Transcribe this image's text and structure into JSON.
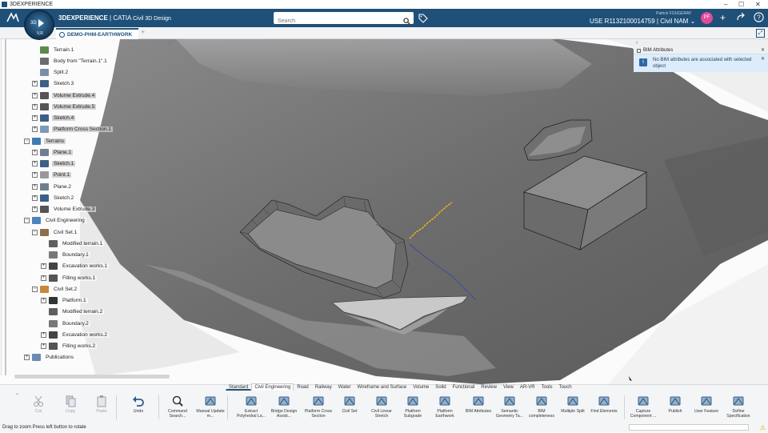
{
  "window": {
    "title": "3DEXPERIENCE",
    "minimize": "–",
    "maximize": "☐",
    "close": "✕"
  },
  "header": {
    "brand_bold": "3DEXPERIENCE",
    "brand_rest": " | CATIA",
    "app_name": "Civil 3D Design",
    "compass_3d": "3D",
    "compass_vr": "V,R",
    "search_placeholder": "Search",
    "user_name": "Patrick FOUGERAY",
    "context": "USE R1132100014759 | Civil NAM",
    "context_chevron": "⌄",
    "avatar": "PF"
  },
  "document_tab": {
    "label": "DEMO-PHM-EARTHWORK",
    "plus": "+"
  },
  "tree": [
    {
      "label": "Terrain.1",
      "indent": 0,
      "exp": "",
      "icon": "terrain",
      "hl": false
    },
    {
      "label": "Body from \"Terrain.1\".1",
      "indent": 0,
      "exp": "",
      "icon": "body",
      "hl": false
    },
    {
      "label": "Split.2",
      "indent": 0,
      "exp": "",
      "icon": "split",
      "hl": false
    },
    {
      "label": "Sketch.3",
      "indent": 0,
      "exp": "+",
      "icon": "sketch",
      "hl": false
    },
    {
      "label": "Volume Extrude.4",
      "indent": 0,
      "exp": "+",
      "icon": "volume",
      "hl": true
    },
    {
      "label": "Volume Extrude.5",
      "indent": 0,
      "exp": "+",
      "icon": "volume",
      "hl": true
    },
    {
      "label": "Sketch.4",
      "indent": 0,
      "exp": "+",
      "icon": "sketch",
      "hl": true
    },
    {
      "label": "Platform Cross Section.1",
      "indent": 0,
      "exp": "+",
      "icon": "cross",
      "hl": true
    },
    {
      "label": "Terrains",
      "indent": -1,
      "exp": "−",
      "icon": "terrains",
      "hl": true
    },
    {
      "label": "Plane.1",
      "indent": 0,
      "exp": "+",
      "icon": "plane",
      "hl": true
    },
    {
      "label": "Sketch.1",
      "indent": 0,
      "exp": "+",
      "icon": "sketch",
      "hl": true
    },
    {
      "label": "Point.1",
      "indent": 0,
      "exp": "+",
      "icon": "point",
      "hl": true
    },
    {
      "label": "Plane.2",
      "indent": 0,
      "exp": "+",
      "icon": "plane",
      "hl": false
    },
    {
      "label": "Sketch.2",
      "indent": 0,
      "exp": "+",
      "icon": "sketch",
      "hl": false
    },
    {
      "label": "Volume Extrude.3",
      "indent": 0,
      "exp": "+",
      "icon": "volume",
      "hl": false
    },
    {
      "label": "Civil Engineering",
      "indent": -1,
      "exp": "−",
      "icon": "civil",
      "hl": false
    },
    {
      "label": "Civil Set.1",
      "indent": 0,
      "exp": "−",
      "icon": "set",
      "hl": false
    },
    {
      "label": "Modified terrain.1",
      "indent": 1,
      "exp": "",
      "icon": "modterrain",
      "hl": false
    },
    {
      "label": "Boundary.1",
      "indent": 1,
      "exp": "",
      "icon": "boundary",
      "hl": false
    },
    {
      "label": "Excavation works.1",
      "indent": 1,
      "exp": "+",
      "icon": "excav",
      "hl": false
    },
    {
      "label": "Filling works.1",
      "indent": 1,
      "exp": "+",
      "icon": "fill",
      "hl": false
    },
    {
      "label": "Civil Set.2",
      "indent": 0,
      "exp": "−",
      "icon": "set2",
      "hl": false
    },
    {
      "label": "Platform.1",
      "indent": 1,
      "exp": "+",
      "icon": "platform",
      "hl": false
    },
    {
      "label": "Modified terrain.2",
      "indent": 1,
      "exp": "",
      "icon": "modterrain",
      "hl": false
    },
    {
      "label": "Boundary.2",
      "indent": 1,
      "exp": "",
      "icon": "boundary",
      "hl": false
    },
    {
      "label": "Excavation works.2",
      "indent": 1,
      "exp": "+",
      "icon": "excav",
      "hl": false
    },
    {
      "label": "Filling works.2",
      "indent": 1,
      "exp": "+",
      "icon": "fill",
      "hl": false
    },
    {
      "label": "Publications",
      "indent": -1,
      "exp": "+",
      "icon": "publications",
      "hl": false
    }
  ],
  "bim_panel": {
    "title": "BIM Attributes",
    "message": "No BIM attributes are associated with selected object",
    "info": "i",
    "close": "✕"
  },
  "action_tabs": [
    "Standard",
    "Civil Engineering",
    "Road",
    "Railway",
    "Water",
    "Wireframe and Surface",
    "Volume",
    "Solid",
    "Functional",
    "Review",
    "View",
    "AR-VR",
    "Tools",
    "Touch"
  ],
  "tools": [
    {
      "label": "Cut",
      "icon": "cut-icon",
      "disabled": true
    },
    {
      "label": "Copy",
      "icon": "copy-icon",
      "disabled": true
    },
    {
      "label": "Paste",
      "icon": "paste-icon",
      "disabled": true
    },
    {
      "label": "Undo",
      "icon": "undo-icon",
      "disabled": false
    },
    {
      "label": "Command Search...",
      "icon": "command-search-icon",
      "disabled": false
    },
    {
      "label": "Manual Update m...",
      "icon": "manual-update-icon",
      "disabled": false
    },
    {
      "label": "Extract Polyhedral La...",
      "icon": "extract-polyhedral-icon",
      "disabled": false
    },
    {
      "label": "Bridge Design Assist...",
      "icon": "bridge-design-icon",
      "disabled": false
    },
    {
      "label": "Platform Cross Section",
      "icon": "platform-cross-section-icon",
      "disabled": false
    },
    {
      "label": "Civil Set",
      "icon": "civil-set-icon",
      "disabled": false
    },
    {
      "label": "Civil Linear Stretch",
      "icon": "civil-linear-stretch-icon",
      "disabled": false
    },
    {
      "label": "Platform Subgrade",
      "icon": "platform-subgrade-icon",
      "disabled": false
    },
    {
      "label": "Platform Earthwork",
      "icon": "platform-earthwork-icon",
      "disabled": false
    },
    {
      "label": "BIM Attributes",
      "icon": "bim-attributes-icon",
      "disabled": false
    },
    {
      "label": "Semantic Geometry Ta...",
      "icon": "semantic-geometry-icon",
      "disabled": false
    },
    {
      "label": "BIM completeness",
      "icon": "bim-completeness-icon",
      "disabled": false
    },
    {
      "label": "Multiple Split",
      "icon": "multiple-split-icon",
      "disabled": false
    },
    {
      "label": "Find Elements",
      "icon": "find-elements-icon",
      "disabled": false
    },
    {
      "label": "Capture Component ...",
      "icon": "capture-component-icon",
      "disabled": false
    },
    {
      "label": "Publish",
      "icon": "publish-icon",
      "disabled": false
    },
    {
      "label": "User Feature",
      "icon": "user-feature-icon",
      "disabled": false
    },
    {
      "label": "Define Specification",
      "icon": "define-specification-icon",
      "disabled": false
    }
  ],
  "status": {
    "text": "Drag to zoom  Press left button to rotate",
    "warning": "⚠"
  },
  "colors": {
    "topbar": "#1f5078",
    "accent": "#1f5078",
    "terrain": "#6f6f6f",
    "centerline_blue": "#3344aa",
    "centerline_yellow": "#e8b21a"
  }
}
